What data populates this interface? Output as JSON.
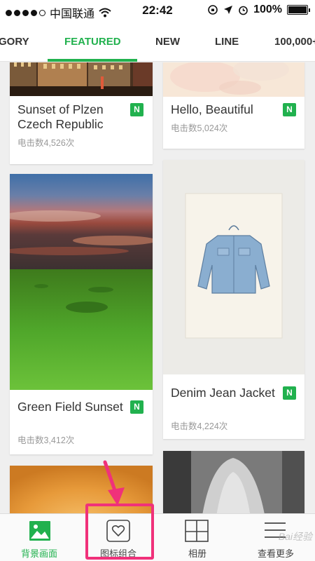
{
  "status_bar": {
    "carrier": "中国联通",
    "time": "22:42",
    "battery": "100%",
    "signal_dots_filled": 4,
    "signal_dots_total": 5
  },
  "tabs": [
    {
      "label": "GORY",
      "active": false
    },
    {
      "label": "FEATURED",
      "active": true
    },
    {
      "label": "NEW",
      "active": false
    },
    {
      "label": "LINE",
      "active": false
    },
    {
      "label": "100,000+",
      "active": false
    }
  ],
  "cards": [
    {
      "title": "Sunset of Plzen Czech Republic",
      "clicks": "电击数4,526次",
      "badge": "N"
    },
    {
      "title": "Hello, Beautiful",
      "clicks": "电击数5,024次",
      "badge": "N"
    },
    {
      "title": "Green Field Sunset",
      "clicks": "电击数3,412次",
      "badge": "N"
    },
    {
      "title": "Denim Jean Jacket",
      "clicks": "电击数4,224次",
      "badge": "N"
    }
  ],
  "bottom_nav": [
    {
      "label": "背景画面",
      "icon": "image-icon",
      "active": true
    },
    {
      "label": "图标组合",
      "icon": "heart-icon",
      "active": false
    },
    {
      "label": "相册",
      "icon": "grid-icon",
      "active": false
    },
    {
      "label": "查看更多",
      "icon": "menu-icon",
      "active": false
    }
  ],
  "watermark": "Bai经验",
  "colors": {
    "accent": "#21b14e",
    "highlight": "#f0317a"
  }
}
